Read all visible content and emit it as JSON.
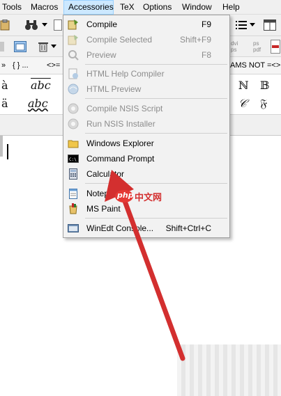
{
  "menubar": {
    "items": [
      {
        "label": "Tools"
      },
      {
        "label": "Macros"
      },
      {
        "label": "Accessories"
      },
      {
        "label": "TeX"
      },
      {
        "label": "Options"
      },
      {
        "label": "Window"
      },
      {
        "label": "Help"
      }
    ]
  },
  "toolbar": {
    "brace_label": "{ } ...",
    "arrows_label": "<>=",
    "ams_not_label": "AMS NOT =<>",
    "dvi_label": "dvi\nps",
    "ps_pdf_label": "ps\npdf"
  },
  "palette": {
    "row1_left": "à",
    "row1_abc": "abc",
    "row2_left": "ä",
    "row2_abc": "abc",
    "row1_right_n": "ℕ",
    "row1_right_b": "𝔹",
    "row2_right_c": "𝒞",
    "row2_right_f": "𝔉"
  },
  "accessories_menu": {
    "items": [
      {
        "label": "Compile",
        "shortcut": "F9",
        "enabled": true,
        "icon": "compile-icon"
      },
      {
        "label": "Compile Selected",
        "shortcut": "Shift+F9",
        "enabled": false,
        "icon": "compile-selected-icon"
      },
      {
        "label": "Preview",
        "shortcut": "F8",
        "enabled": false,
        "icon": "magnifier-icon"
      },
      {
        "label": "HTML Help Compiler",
        "shortcut": "",
        "enabled": false,
        "icon": "html-help-icon"
      },
      {
        "label": "HTML Preview",
        "shortcut": "",
        "enabled": false,
        "icon": "html-preview-icon"
      },
      {
        "label": "Compile NSIS Script",
        "shortcut": "",
        "enabled": false,
        "icon": "nsis-compile-icon"
      },
      {
        "label": "Run NSIS Installer",
        "shortcut": "",
        "enabled": false,
        "icon": "nsis-run-icon"
      },
      {
        "label": "Windows Explorer",
        "shortcut": "",
        "enabled": true,
        "icon": "folder-icon"
      },
      {
        "label": "Command Prompt",
        "shortcut": "",
        "enabled": true,
        "icon": "cmd-icon"
      },
      {
        "label": "Calculator",
        "shortcut": "",
        "enabled": true,
        "icon": "calculator-icon"
      },
      {
        "label": "Notepad",
        "shortcut": "",
        "enabled": true,
        "icon": "notepad-icon"
      },
      {
        "label": "MS Paint",
        "shortcut": "",
        "enabled": true,
        "icon": "paint-icon"
      },
      {
        "label": "WinEdt Console...",
        "shortcut": "Shift+Ctrl+C",
        "enabled": true,
        "icon": "console-icon"
      }
    ]
  },
  "watermark": {
    "brand": "php",
    "site": "中文网"
  },
  "colors": {
    "menu_highlight": "#cce8ff",
    "arrow_red": "#d32f2f",
    "menu_bg": "#f2f2f2"
  }
}
